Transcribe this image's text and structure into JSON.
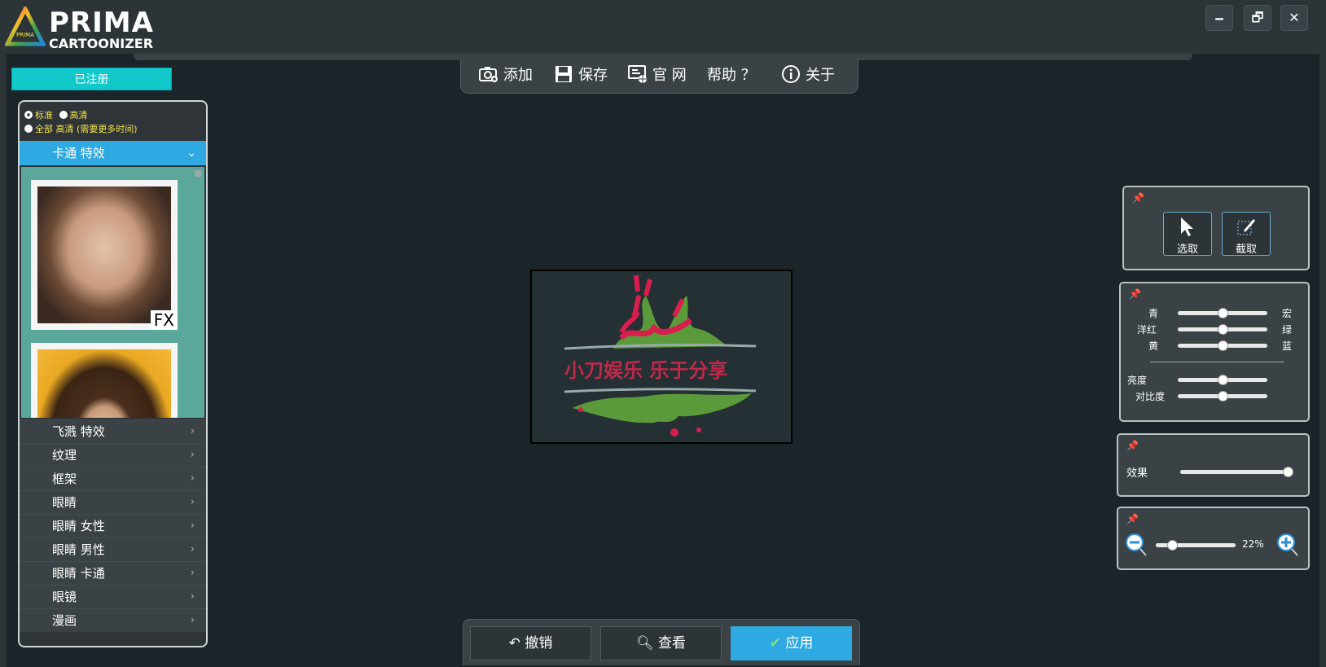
{
  "app": {
    "brand_line1": "PRIMA",
    "brand_line2": "CARTOONIZER",
    "logo_small": "PRIMA"
  },
  "window_buttons": {
    "minimize": "🗕",
    "restore": "🗗",
    "close": "✕"
  },
  "registered_label": "已注册",
  "quality": {
    "standard": "标准",
    "hd": "高清",
    "all_hd": "全部 高清 (需要更多时间)"
  },
  "category_header": "卡通 特效",
  "thumb1_badge": "FX",
  "categories": [
    "飞溅 特效",
    "纹理",
    "框架",
    "眼睛",
    "眼睛 女性",
    "眼睛 男性",
    "眼睛 卡通",
    "眼镜",
    "漫画"
  ],
  "toolbar": {
    "add": "添加",
    "save": "保存",
    "website": "官 网",
    "help": "帮助 ？",
    "about": "关于"
  },
  "canvas_text": "小刀娱乐 乐于分享",
  "tools": {
    "select": "选取",
    "crop": "截取"
  },
  "color_balance": {
    "cyan": "青",
    "red": "宏",
    "magenta": "洋红",
    "green": "绿",
    "yellow": "黄",
    "blue": "蓝",
    "brightness": "亮度",
    "contrast": "对比度"
  },
  "effect": {
    "label": "效果",
    "level": 1.0
  },
  "zoom": {
    "value": "22%"
  },
  "bottom": {
    "undo": "撤销",
    "view": "查看",
    "apply": "应用"
  },
  "colors": {
    "accent": "#2fa9e2",
    "registered": "#11c9cb",
    "background": "#1b2529"
  }
}
